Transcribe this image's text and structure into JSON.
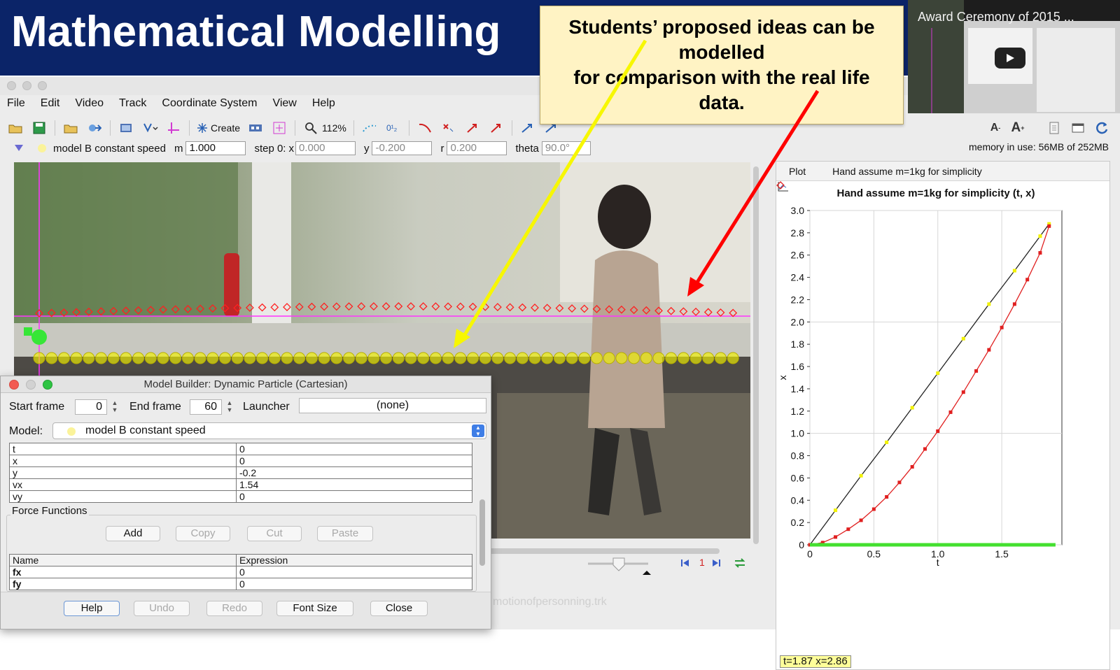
{
  "slide": {
    "title": "Mathematical Modelling"
  },
  "callout": {
    "lines": [
      "Students’ proposed ideas can be",
      "modelled",
      "for comparison with the real life",
      "data."
    ],
    "arrow_colors": [
      "#f7f700",
      "#ff0000"
    ]
  },
  "video_thumb": {
    "title": "Award Ceremony of 2015 ...",
    "icon": "play-icon"
  },
  "menu": [
    "File",
    "Edit",
    "Video",
    "Track",
    "Coordinate System",
    "View",
    "Help"
  ],
  "toolbar": {
    "create_label": "Create",
    "zoom_label": "112%"
  },
  "params": {
    "track_name": "model B constant speed",
    "m_label": "m",
    "m_value": "1.000",
    "step_label": "step 0:",
    "x_label": "x",
    "x_value": "0.000",
    "y_label": "y",
    "y_value": "-0.200",
    "r_label": "r",
    "r_value": "0.200",
    "theta_label": "theta",
    "theta_value": "90.0°",
    "memory": "memory in use: 56MB of 252MB"
  },
  "video": {
    "frame_number": "1",
    "filename": "motionofpersonning.trk",
    "track_colors": {
      "real": "#ff2020",
      "model": "#f2f200",
      "axis": "#ff33ff"
    }
  },
  "plot": {
    "tab_label": "Plot",
    "track_label": "Hand assume m=1kg for simplicity",
    "readout": "t=1.87  x=2.86"
  },
  "chart_data": {
    "type": "line",
    "title": "Hand assume m=1kg for simplicity (t, x)",
    "xlabel": "t",
    "ylabel": "x",
    "xlim": [
      0,
      1.97
    ],
    "ylim": [
      0,
      3.0
    ],
    "xticks": [
      "0",
      "0.5",
      "1.0",
      "1.5"
    ],
    "yticks": [
      "0",
      "0.2",
      "0.4",
      "0.6",
      "0.8",
      "1.0",
      "1.2",
      "1.4",
      "1.6",
      "1.8",
      "2.0",
      "2.2",
      "2.4",
      "2.6",
      "2.8",
      "3.0"
    ],
    "grid": true,
    "series": [
      {
        "color": "#f2f200",
        "x": [
          0,
          0.2,
          0.4,
          0.6,
          0.8,
          1.0,
          1.2,
          1.4,
          1.6,
          1.8,
          1.87
        ],
        "y": [
          0,
          0.31,
          0.62,
          0.92,
          1.23,
          1.54,
          1.85,
          2.16,
          2.46,
          2.77,
          2.88
        ]
      },
      {
        "color": "#e02020",
        "x": [
          0,
          0.1,
          0.2,
          0.3,
          0.4,
          0.5,
          0.6,
          0.7,
          0.8,
          0.9,
          1.0,
          1.1,
          1.2,
          1.3,
          1.4,
          1.5,
          1.6,
          1.7,
          1.8,
          1.87
        ],
        "y": [
          0,
          0.02,
          0.07,
          0.14,
          0.22,
          0.32,
          0.43,
          0.56,
          0.7,
          0.86,
          1.02,
          1.19,
          1.37,
          1.56,
          1.75,
          1.95,
          2.16,
          2.38,
          2.62,
          2.86
        ]
      },
      {
        "color": "#44e030",
        "x": [
          0,
          1.92
        ],
        "y": [
          0,
          0
        ]
      }
    ]
  },
  "dialog": {
    "title": "Model Builder: Dynamic Particle (Cartesian)",
    "start_label": "Start frame",
    "start_value": "0",
    "end_label": "End frame",
    "end_value": "60",
    "launcher_label": "Launcher",
    "launcher_value": "(none)",
    "model_label": "Model:",
    "model_value": "model B constant speed",
    "initial_values": [
      {
        "name": "t",
        "value": "0"
      },
      {
        "name": "x",
        "value": "0"
      },
      {
        "name": "y",
        "value": "-0.2"
      },
      {
        "name": "vx",
        "value": "1.54"
      },
      {
        "name": "vy",
        "value": "0"
      }
    ],
    "force_group_label": "Force Functions",
    "force_buttons": [
      "Add",
      "Copy",
      "Cut",
      "Paste"
    ],
    "force_headers": [
      "Name",
      "Expression"
    ],
    "forces": [
      {
        "name": "fx",
        "expr": "0"
      },
      {
        "name": "fy",
        "expr": "0"
      }
    ],
    "bottom_buttons": [
      "Help",
      "Undo",
      "Redo",
      "Font Size",
      "Close"
    ]
  }
}
